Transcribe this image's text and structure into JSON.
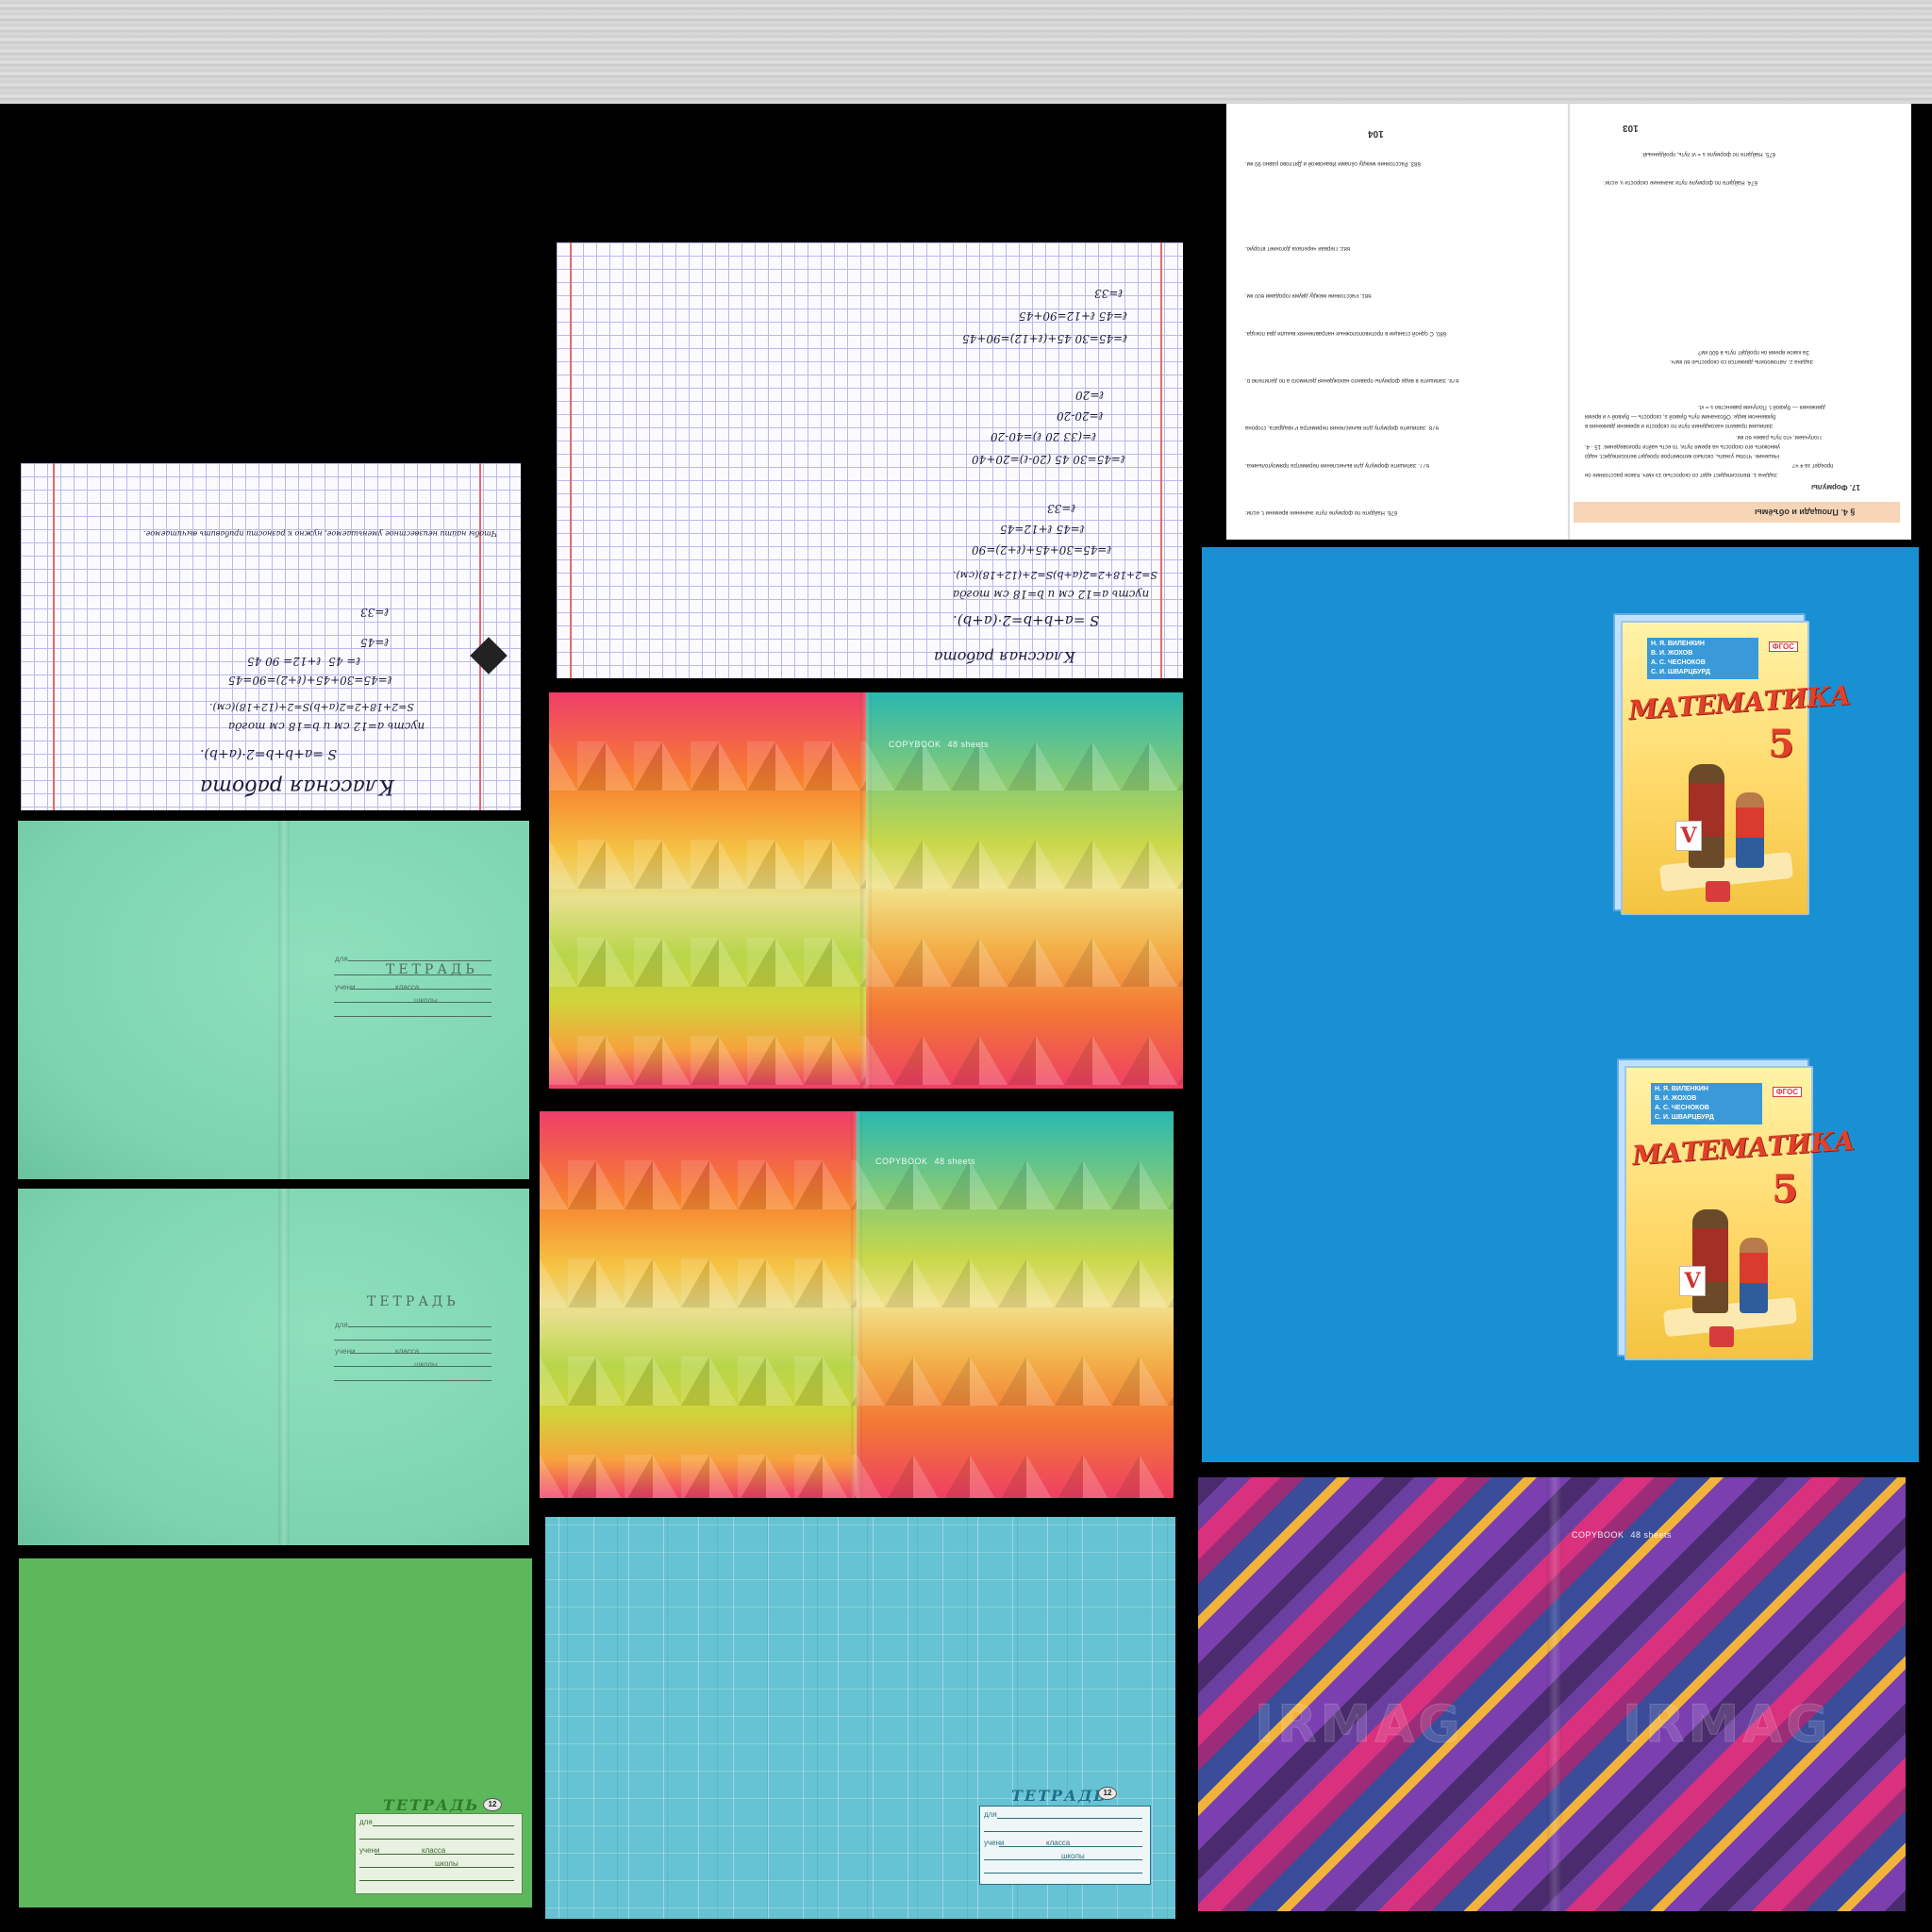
{
  "grid_page_small": {
    "title": "Классная работа",
    "lines": [
      "S =a+b+b=2·(a+b).",
      "пусть a=12 см и b=18 см тогда",
      "S=2+18+2=2(a+b)S=2+(12+18)(см).",
      "ℓ=45=30+45+(ℓ+2)=90=45",
      "ℓ= 45  ℓ+12= 90 45",
      "ℓ=45",
      "ℓ=33"
    ],
    "note": "Чтобы найти неизвестное уменьшаемое, нужно к разности прибавить вычитаемое."
  },
  "grid_page_large": {
    "title": "Классная работа",
    "lines": [
      "S =a+b+b=2·(a+b).",
      "пусть a=12 см и b=18 см тогда",
      "S=2+18+2=2(a+b)S=2+(12+18)(см).",
      "ℓ=45=30+45+(ℓ+2)=90",
      "ℓ=45 ℓ+12=45",
      "ℓ=33",
      "ℓ=45=30 45 (20-ℓ)=20+40",
      "ℓ=(33 20 ℓ)=40-20",
      "ℓ=20-20",
      "ℓ=20",
      "ℓ=45=30 45+(ℓ+12)=90+45",
      "ℓ=45 ℓ+12=90+45",
      "ℓ=33"
    ]
  },
  "mint_covers": [
    {
      "title": "ТЕТРАДЬ",
      "line_labels": [
        "для",
        "учени",
        "класса",
        "школы"
      ]
    },
    {
      "title": "ТЕТРАДЬ",
      "line_labels": [
        "для",
        "учени",
        "класса",
        "школы"
      ]
    }
  ],
  "geo_covers": [
    {
      "brand": "COPYBOOK",
      "sheets": "48 sheets"
    },
    {
      "brand": "COPYBOOK",
      "sheets": "48 sheets"
    }
  ],
  "green_cover": {
    "title": "ТЕТРАДЬ",
    "pages": "12",
    "line_labels": [
      "для",
      "учени",
      "класса",
      "школы"
    ]
  },
  "teal_cover": {
    "title": "ТЕТРАДЬ",
    "pages": "12",
    "line_labels": [
      "для",
      "учени",
      "класса",
      "школы"
    ]
  },
  "diag_cover": {
    "brand": "COPYBOOK",
    "sheets": "48 sheets",
    "watermark": "IRMAG"
  },
  "textbook_pages": {
    "page_left": "104",
    "page_right": "103",
    "section": "§ 4. Площади и объёмы",
    "subsection": "17. Формулы",
    "lines": [
      "Задача 1. Велосипедист едет со скоростью 15 км/ч. Какое расстояние он",
      "проедет за 4 ч?",
      "Решение. Чтобы узнать, сколько километров проедет велосипедист, надо",
      "умножить его скорость на время пути, то есть найти произведение: 15 · 4.",
      "Получаем, что путь равен 60 км.",
      "Запишем правило нахождения пути по скорости и времени движения в",
      "буквенном виде. Обозначим путь буквой s, скорость — буквой v и время",
      "движения — буквой t. Получим равенство s = vt.",
      "Задача 2. Автомобиль движется со скоростью 60 км/ч.",
      "За какое время он пройдёт путь в 600 км?",
      "676. Найдите по формуле пути значение времени t, если:",
      "677. Запишите формулу для вычисления периметра прямоугольника.",
      "678. Запишите формулу для вычисления периметра P квадрата, сторона",
      "679. Запишите в виде формулы правило нахождения делимого a по делителю b.",
      "680. С одной станции в противоположных направлениях вышли два поезда.",
      "681. Расстояние между двумя городами 600 км.",
      "682. Первая черепаха догоняет вторую.",
      "683. Расстояние между сёлами Ивановкой и Дятлово равно 90 км.",
      "674. Найдите по формуле пути значение скорости v, если:",
      "675. Найдите по формуле s = vt путь, пройденный:"
    ]
  },
  "math_books": [
    {
      "title": "МАТЕМАТИКА",
      "grade": "5",
      "authors": [
        "Н. Я. ВИЛЕНКИН",
        "В. И. ЖОХОВ",
        "А. С. ЧЕСНОКОВ",
        "С. И. ШВАРЦБУРД"
      ],
      "badge": "ФГОС"
    },
    {
      "title": "МАТЕМАТИКА",
      "grade": "5",
      "authors": [
        "Н. Я. ВИЛЕНКИН",
        "В. И. ЖОХОВ",
        "А. С. ЧЕСНОКОВ",
        "С. И. ШВАРЦБУРД"
      ],
      "badge": "ФГОС"
    }
  ]
}
